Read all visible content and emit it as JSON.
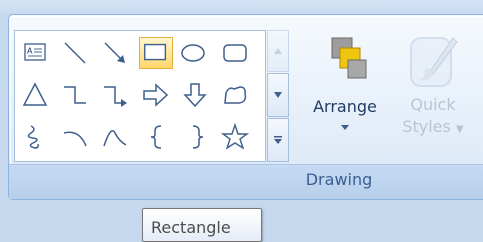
{
  "ribbon": {
    "group_label": "Drawing",
    "shapes_gallery": {
      "items": [
        {
          "name": "text-box"
        },
        {
          "name": "line"
        },
        {
          "name": "arrow"
        },
        {
          "name": "rectangle",
          "selected": true
        },
        {
          "name": "oval"
        },
        {
          "name": "rounded-rectangle"
        },
        {
          "name": "triangle"
        },
        {
          "name": "elbow-connector"
        },
        {
          "name": "elbow-arrow-connector"
        },
        {
          "name": "right-arrow"
        },
        {
          "name": "down-arrow"
        },
        {
          "name": "freeform"
        },
        {
          "name": "curve"
        },
        {
          "name": "arc"
        },
        {
          "name": "curved-line"
        },
        {
          "name": "left-brace"
        },
        {
          "name": "right-brace"
        },
        {
          "name": "star"
        }
      ],
      "scroll_up_disabled": true
    },
    "arrange": {
      "label": "Arrange",
      "icon": "arrange-icon"
    },
    "quick_styles": {
      "label_line1": "Quick",
      "label_line2": "Styles",
      "icon": "quick-styles-icon",
      "disabled": true
    }
  },
  "tooltip": {
    "text": "Rectangle"
  },
  "colors": {
    "accent_blue": "#3b5f93",
    "selected_fill": "#ffd86b",
    "disabled_text": "#9aa9bd"
  }
}
